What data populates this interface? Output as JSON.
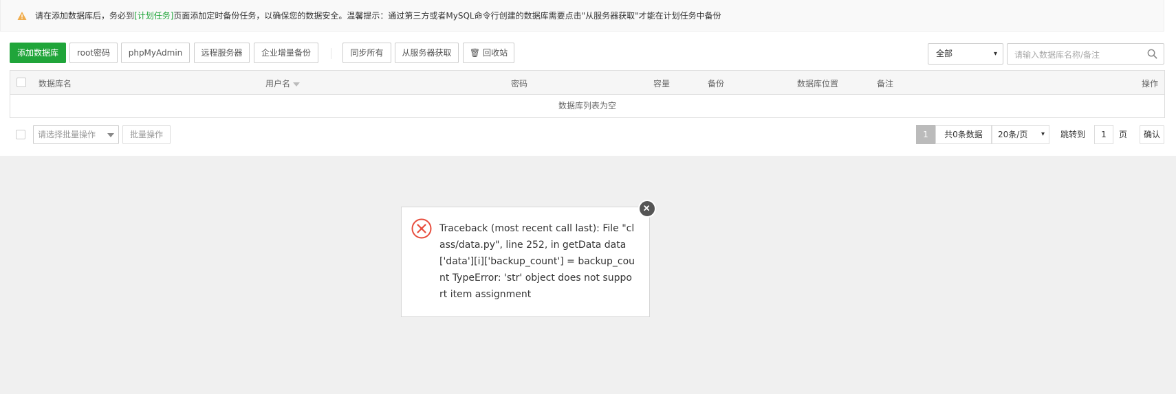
{
  "alert": {
    "text_before": "请在添加数据库后，务必到",
    "link": "[计划任务]",
    "text_after": "页面添加定时备份任务，以确保您的数据安全。温馨提示：通过第三方或者MySQL命令行创建的数据库需要点击\"从服务器获取\"才能在计划任务中备份"
  },
  "toolbar": {
    "add_db": "添加数据库",
    "root_pwd": "root密码",
    "phpmyadmin": "phpMyAdmin",
    "remote_server": "远程服务器",
    "enterprise_backup": "企业增量备份",
    "sync_all": "同步所有",
    "fetch_from_server": "从服务器获取",
    "recycle_bin": "回收站",
    "filter_value": "全部",
    "search_placeholder": "请输入数据库名称/备注"
  },
  "table": {
    "columns": [
      "数据库名",
      "用户名",
      "密码",
      "容量",
      "备份",
      "数据库位置",
      "备注",
      "操作"
    ],
    "empty_text": "数据库列表为空"
  },
  "footer": {
    "batch_placeholder": "请选择批量操作",
    "batch_button": "批量操作",
    "current_page": "1",
    "total_text": "共0条数据",
    "page_size": "20条/页",
    "jump_label": "跳转到",
    "jump_value": "1",
    "page_label": "页",
    "confirm": "确认"
  },
  "dialog": {
    "message": "Traceback (most recent call last): File \"class/data.py\", line 252, in getData data['data'][i]['backup_count'] = backup_count TypeError: 'str' object does not support item assignment"
  },
  "colors": {
    "primary": "#20a53a",
    "warning": "#f0ad4e",
    "error": "#e74c3c"
  }
}
